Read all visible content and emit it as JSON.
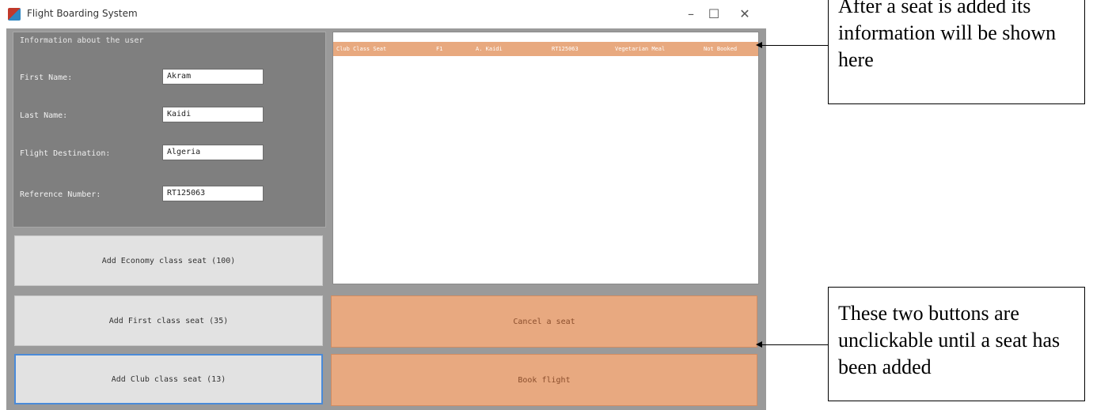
{
  "window": {
    "title": "Flight Boarding System",
    "controls": {
      "minimize": "–",
      "maximize": "☐",
      "close": "✕"
    }
  },
  "info_group": {
    "title": "Information about the user",
    "fields": [
      {
        "label": "First Name:",
        "value": "Akram"
      },
      {
        "label": "Last Name:",
        "value": "Kaidi"
      },
      {
        "label": "Flight Destination:",
        "value": "Algeria"
      },
      {
        "label": "Reference Number:",
        "value": "RT125063"
      }
    ]
  },
  "seat_buttons": {
    "economy": "Add Economy class seat (100)",
    "first": "Add First class seat (35)",
    "club": "Add Club class seat (13)"
  },
  "seat_list": {
    "rows": [
      {
        "class": "Club Class Seat",
        "seat": "F1",
        "name": "A. Kaidi",
        "reference": "RT125063",
        "meal": "Vegetarian Meal",
        "status": "Not Booked"
      }
    ]
  },
  "action_buttons": {
    "cancel": "Cancel a seat",
    "book": "Book flight"
  },
  "callouts": {
    "top": "After a seat is added its information will be shown here",
    "bottom": "These two buttons are unclickable until a seat has been added"
  },
  "colors": {
    "accent_orange": "#e8a980",
    "form_background": "#9a9a9a",
    "focus_blue": "#4a8ad8"
  }
}
